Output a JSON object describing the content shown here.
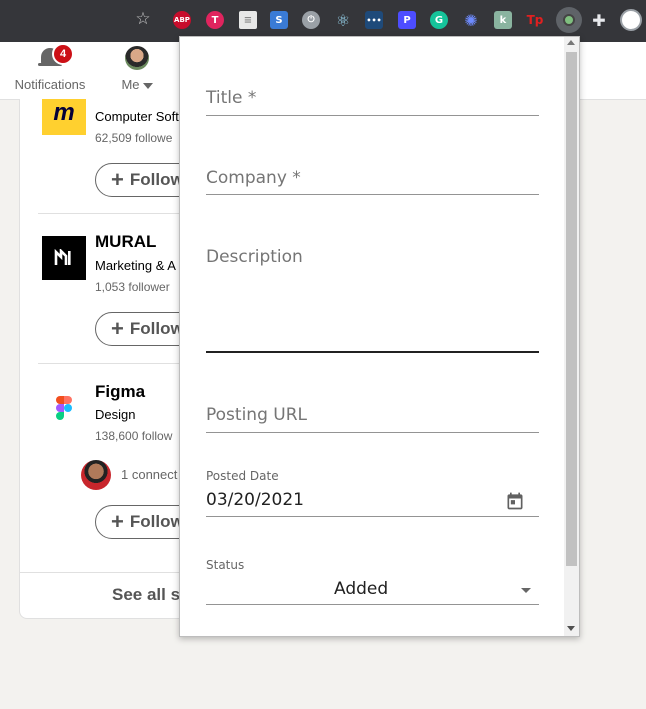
{
  "browser": {
    "extensions": [
      "abp-icon",
      "t-extension-icon",
      "document-icon",
      "s-extension-icon",
      "power-icon",
      "react-devtools-icon",
      "dots-icon",
      "p-extension-icon",
      "grammarly-icon",
      "flower-icon",
      "k-extension-icon",
      "tp-extension-icon",
      "active-extension-icon",
      "puzzle-icon",
      "profile-icon"
    ],
    "abp_label": "ABP",
    "tp_label": "Tp"
  },
  "nav": {
    "notifications": {
      "label": "Notifications",
      "badge": "4"
    },
    "me": {
      "label": "Me"
    }
  },
  "companies": [
    {
      "name": "",
      "industry": "Computer Soft",
      "followers": "62,509 followe",
      "follow_label": "Follow"
    },
    {
      "name": "MURAL",
      "industry": "Marketing & A",
      "followers": "1,053 follower",
      "follow_label": "Follow"
    },
    {
      "name": "Figma",
      "industry": "Design",
      "followers": "138,600 follow",
      "connection": "1 connect",
      "follow_label": "Follow"
    }
  ],
  "see_all": "See all s",
  "popup": {
    "title_placeholder": "Title *",
    "company_placeholder": "Company *",
    "description_placeholder": "Description",
    "posting_url_placeholder": "Posting URL",
    "posted_date_label": "Posted Date",
    "posted_date_value": "03/20/2021",
    "status_label": "Status",
    "status_value": "Added"
  }
}
